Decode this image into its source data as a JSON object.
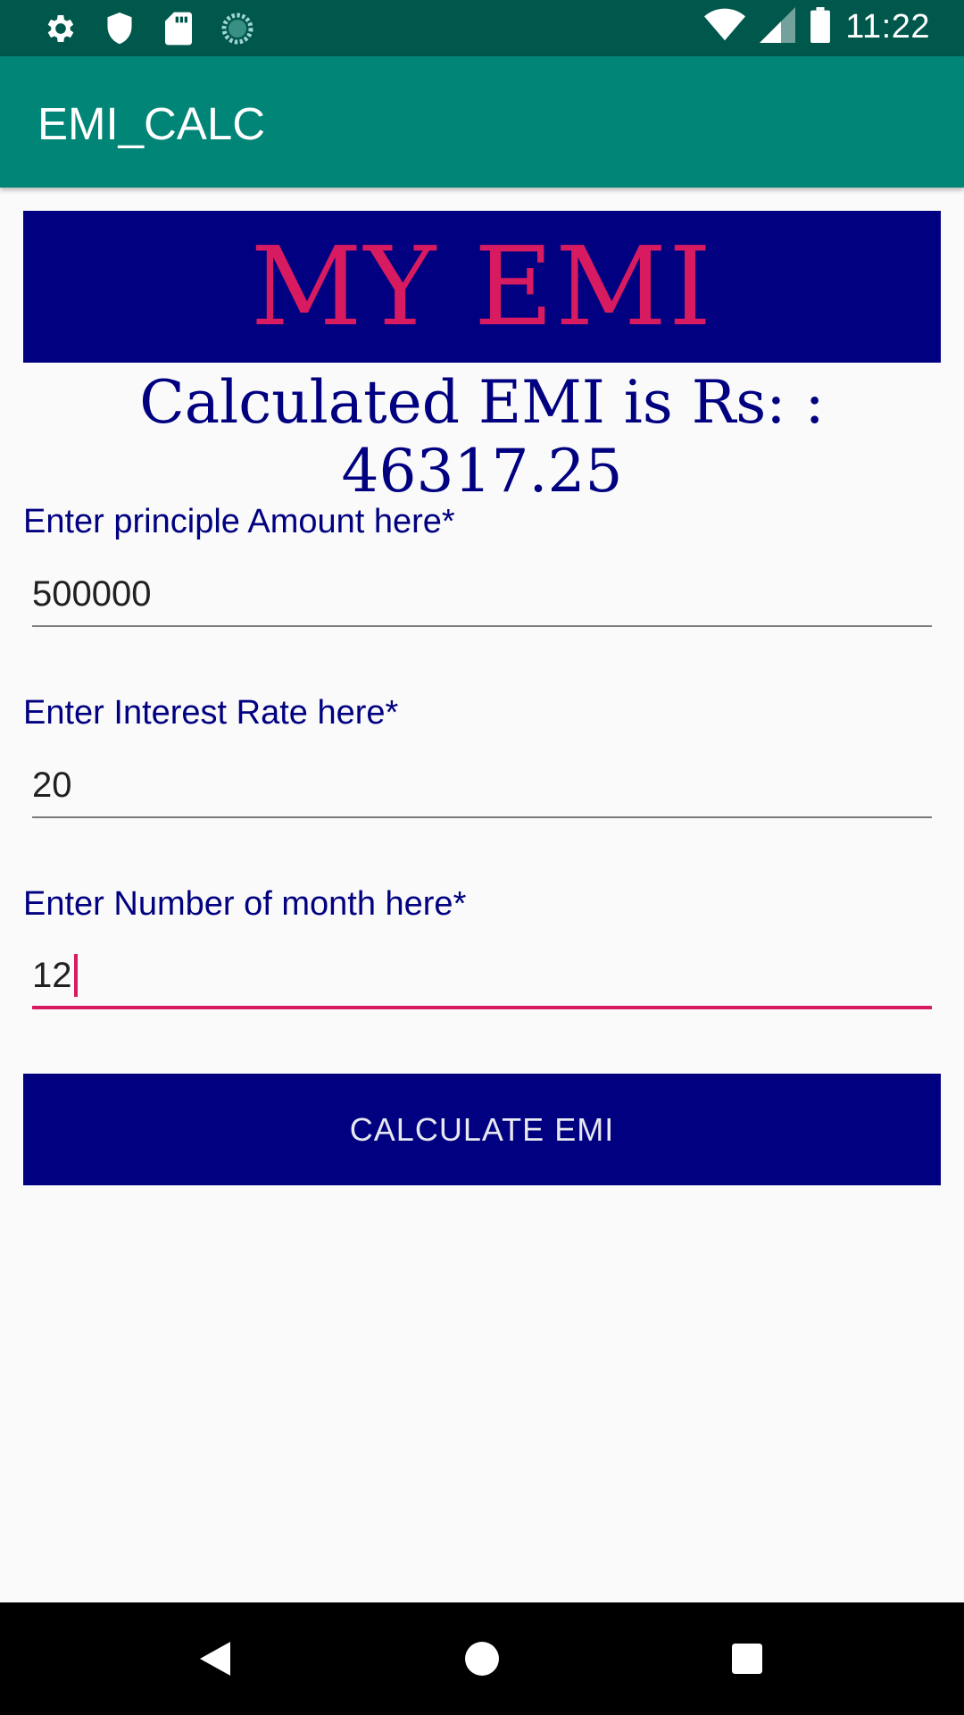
{
  "status_bar": {
    "time": "11:22",
    "left_icons": [
      "settings-icon",
      "shield-icon",
      "sd-card-icon",
      "sync-icon"
    ],
    "right_icons": [
      "wifi-icon",
      "signal-icon",
      "battery-icon"
    ]
  },
  "app_bar": {
    "title": "EMI_CALC"
  },
  "banner": {
    "text": "MY EMI"
  },
  "result": {
    "text": "Calculated EMI is Rs: : 46317.25"
  },
  "form": {
    "principal": {
      "label": "Enter principle Amount here*",
      "value": "500000"
    },
    "rate": {
      "label": "Enter Interest Rate here*",
      "value": "20"
    },
    "months": {
      "label": "Enter Number of month here*",
      "value": "12"
    }
  },
  "button": {
    "label": "CALCULATE EMI"
  },
  "nav_bar": {
    "buttons": [
      "back-icon",
      "home-icon",
      "recents-icon"
    ]
  },
  "colors": {
    "status_bar": "#00574b",
    "app_bar": "#008577",
    "navy": "#000080",
    "accent": "#d81b60"
  }
}
